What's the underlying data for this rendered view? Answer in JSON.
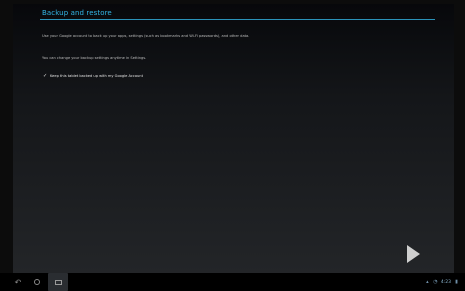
{
  "setup": {
    "heading": "Backup and restore",
    "description_1": "Use your Google account to back up your apps, settings (such as bookmarks and Wi-Fi passwords), and other data.",
    "description_2": "You can change your backup settings anytime in Settings.",
    "backup_checkbox_label": "Keep this tablet backed up with my Google Account",
    "backup_checked": true,
    "check_glyph": "✓"
  },
  "navigation": {
    "back_glyph": "↶"
  },
  "status_bar": {
    "time": "4:23"
  },
  "icons": {
    "next": "play-arrow-icon",
    "back": "back-icon",
    "home": "home-icon",
    "recent": "recent-apps-icon",
    "tray": [
      "network-icon",
      "wifi-icon",
      "battery-icon"
    ]
  },
  "colors": {
    "accent": "#33b5e5",
    "background_top": "#07080b",
    "background_bottom": "#232528",
    "navbar": "#000000"
  }
}
